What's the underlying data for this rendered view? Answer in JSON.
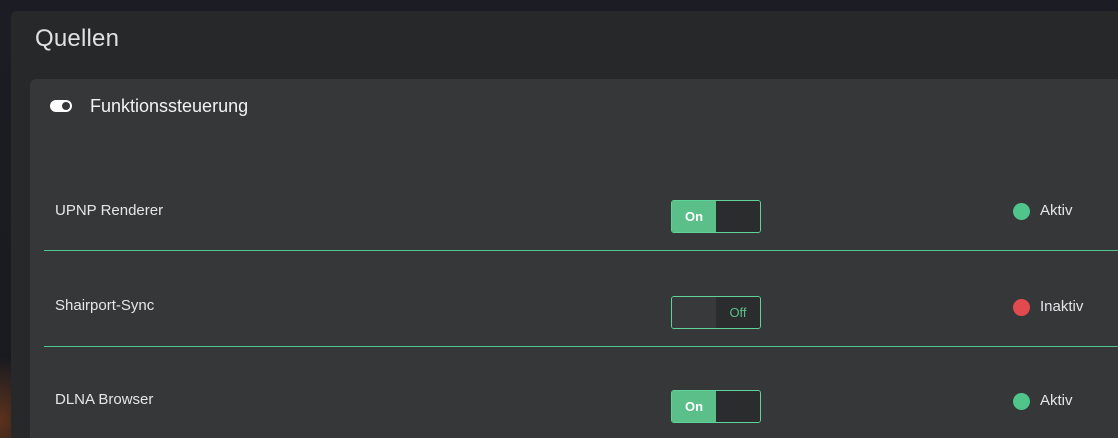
{
  "panel": {
    "title": "Quellen"
  },
  "card": {
    "title": "Funktionssteuerung",
    "icon": "toggle-icon"
  },
  "rows": [
    {
      "label": "UPNP Renderer",
      "switch_state": "On",
      "status": "Aktiv",
      "status_color": "#4fc48b"
    },
    {
      "label": "Shairport-Sync",
      "switch_state": "Off",
      "status": "Inaktiv",
      "status_color": "#e34a4f"
    },
    {
      "label": "DLNA Browser",
      "switch_state": "On",
      "status": "Aktiv",
      "status_color": "#4fc48b"
    }
  ],
  "colors": {
    "accent": "#5bbf8a",
    "active": "#4fc48b",
    "inactive": "#e34a4f"
  }
}
